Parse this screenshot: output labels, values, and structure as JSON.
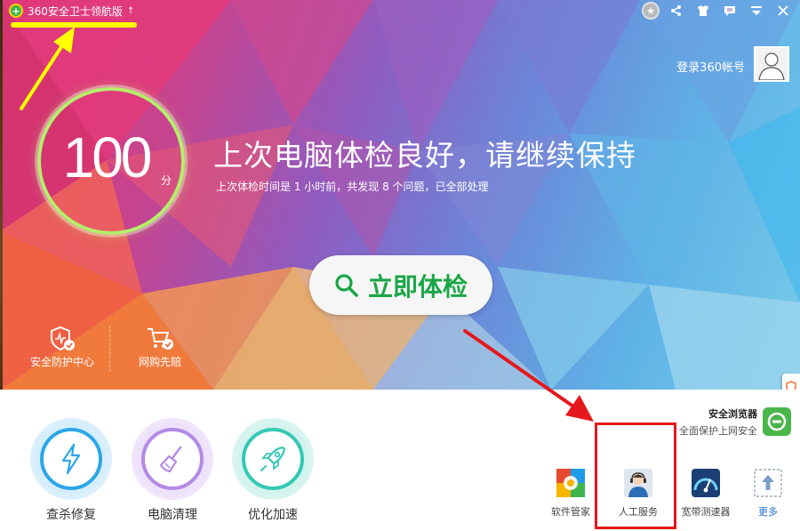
{
  "window": {
    "title": "360安全卫士领航版",
    "title_arrow": "↑",
    "controls": [
      "medal-icon",
      "share-icon",
      "skin-icon",
      "feedback-icon",
      "menu-icon",
      "close-icon"
    ]
  },
  "account": {
    "login_label": "登录360帐号"
  },
  "score": {
    "value": "100",
    "unit": "分"
  },
  "status": {
    "headline": "上次电脑体检良好，请继续保持",
    "detail": "上次体检时间是 1 小时前，共发现 8 个问题，已全部处理"
  },
  "check_button": {
    "label": "立即体检"
  },
  "hero_links": [
    {
      "label": "安全防护中心",
      "icon": "shield-check-icon"
    },
    {
      "label": "网购先赔",
      "icon": "cart-check-icon"
    }
  ],
  "tools": [
    {
      "label": "查杀修复",
      "icon": "lightning-icon",
      "color": "#2ea6e8"
    },
    {
      "label": "电脑清理",
      "icon": "broom-icon",
      "color": "#b58ae6"
    },
    {
      "label": "优化加速",
      "icon": "rocket-icon",
      "color": "#35c9b4"
    }
  ],
  "browser_promo": {
    "title": "安全浏览器",
    "subtitle": "全面保护上网安全",
    "color": "#49b649"
  },
  "apps": [
    {
      "label": "软件管家",
      "icon": "software-manager-icon"
    },
    {
      "label": "人工服务",
      "icon": "support-agent-icon"
    },
    {
      "label": "宽带测速器",
      "icon": "speedometer-icon"
    },
    {
      "label": "更多",
      "icon": "more-upload-icon"
    }
  ],
  "colors": {
    "accent_green": "#1aa646",
    "annotation_yellow": "#ffff00",
    "annotation_red": "#e5191d",
    "link_blue": "#1f70d6"
  }
}
